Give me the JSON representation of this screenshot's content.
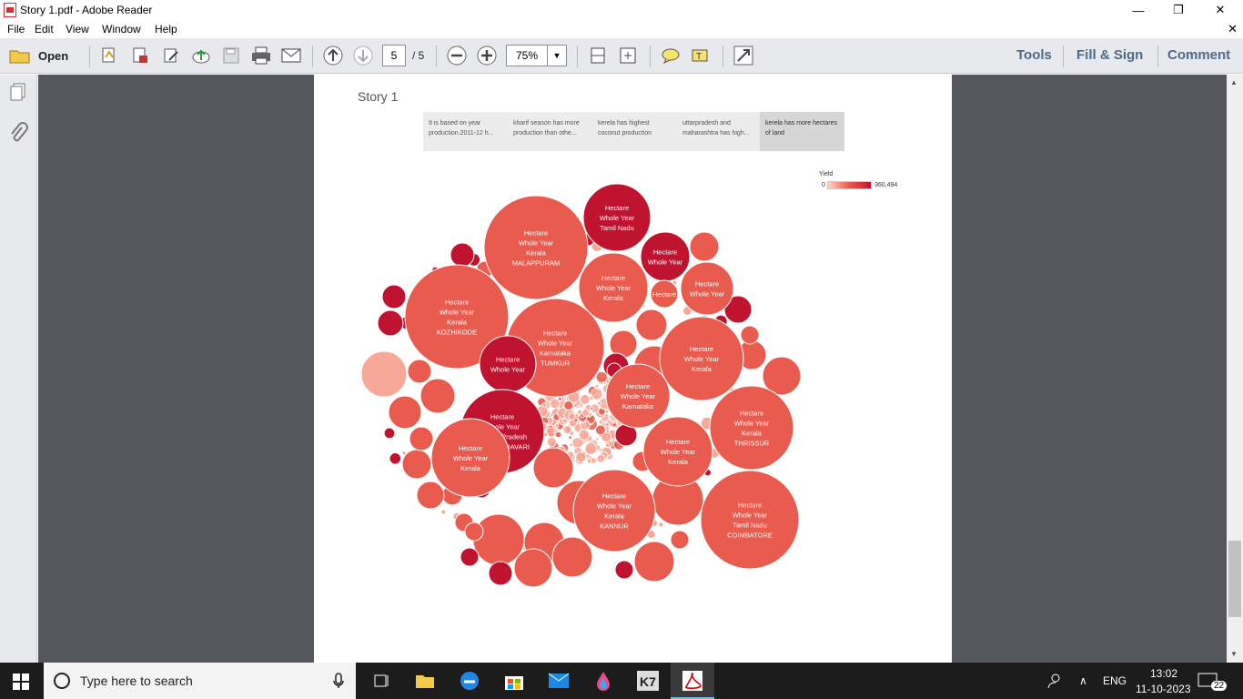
{
  "window": {
    "title": "Story 1.pdf - Adobe Reader",
    "minimize": "—",
    "maximize": "❐",
    "close": "✕"
  },
  "menu": [
    "File",
    "Edit",
    "View",
    "Window",
    "Help"
  ],
  "menu_close": "✕",
  "toolbar": {
    "open_label": "Open",
    "page_current": "5",
    "page_total": "/ 5",
    "zoom": "75%",
    "tools": "Tools",
    "fill_sign": "Fill & Sign",
    "comment": "Comment"
  },
  "document": {
    "story_title": "Story 1",
    "story_points": [
      "It is based on year production.2011-12 h...",
      "kharif season has more production than othe...",
      "kerela has highest coconut production",
      "uttarpradesh  and maharashtra has high...",
      "kerela has more hectares of land"
    ],
    "legend": {
      "title": "Yield",
      "min": "0",
      "max": "360,494"
    }
  },
  "chart_data": {
    "type": "bubble",
    "color_measure": "Yield",
    "color_range": [
      0,
      360494
    ],
    "labeled_bubbles": [
      {
        "lines": [
          "Hectare",
          "Whole Year",
          "Kerala",
          "MALAPPURAM"
        ]
      },
      {
        "lines": [
          "Hectare",
          "Whole Year",
          "Tamil Nadu"
        ]
      },
      {
        "lines": [
          "Hectare",
          "Whole Year"
        ]
      },
      {
        "lines": [
          "Hectare",
          "Whole Year",
          "Kerala",
          "KOZHIKODE"
        ]
      },
      {
        "lines": [
          "Hectare",
          "Whole Year",
          "Kerala"
        ]
      },
      {
        "lines": [
          "Hectare"
        ]
      },
      {
        "lines": [
          "Hectare",
          "Whole Year"
        ]
      },
      {
        "lines": [
          "Hectare",
          "Whole Year",
          "Karnataka",
          "TUMKUR"
        ]
      },
      {
        "lines": [
          "Hectare",
          "Whole Year",
          "Kerala"
        ]
      },
      {
        "lines": [
          "Hectare",
          "Whole Year"
        ]
      },
      {
        "lines": [
          "Hectare",
          "Whole Year",
          "Karnataka"
        ]
      },
      {
        "lines": [
          "Hectare",
          "Whole Year",
          "Kerala",
          "THRISSUR"
        ]
      },
      {
        "lines": [
          "Hectare",
          "Whole Year",
          "Andhra Pradesh",
          "EAST GODAVARI"
        ]
      },
      {
        "lines": [
          "Hectare",
          "Whole Year",
          "Kerala"
        ]
      },
      {
        "lines": [
          "Hectare",
          "Whole Year",
          "Kerala"
        ]
      },
      {
        "lines": [
          "Hectare",
          "Whole Year",
          "Tamil Nadu",
          "COIMBATORE"
        ]
      },
      {
        "lines": [
          "Hectare",
          "Whole Year",
          "Kerala",
          "KANNUR"
        ]
      }
    ]
  },
  "taskbar": {
    "search_placeholder": "Type here to search",
    "lang": "ENG",
    "time": "13:02",
    "date": "11-10-2023",
    "notif": "22"
  },
  "colors": {
    "accent": "#e85b4e",
    "dark": "#c01330",
    "light": "#f7a898",
    "toolbar": "#e8e9ec",
    "docbg": "#54575c"
  }
}
